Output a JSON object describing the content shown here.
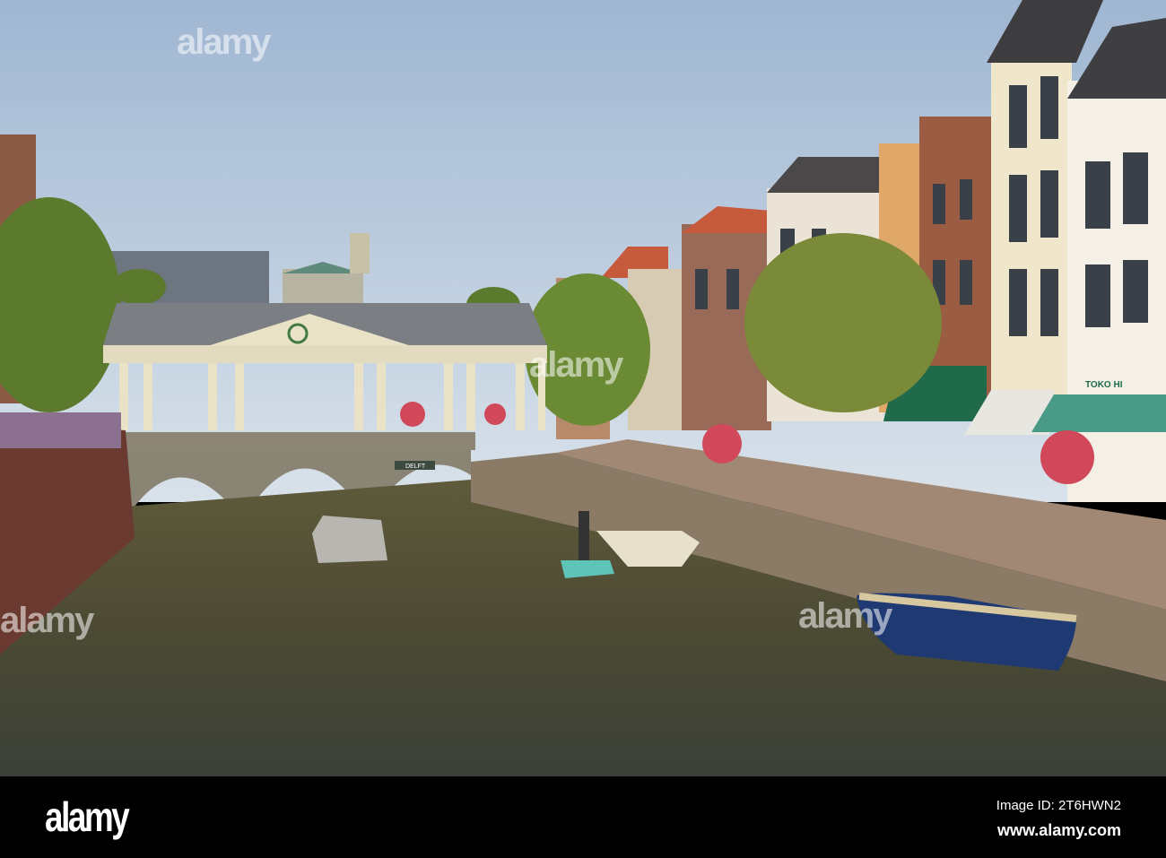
{
  "photo": {
    "signs": {
      "shop": "TOKO HI",
      "boat": "DELFT"
    }
  },
  "watermark": {
    "logo": "alamy"
  },
  "footer": {
    "logo": "alamy",
    "image_id": "Image ID: 2T6HWN2",
    "website": "www.alamy.com"
  }
}
